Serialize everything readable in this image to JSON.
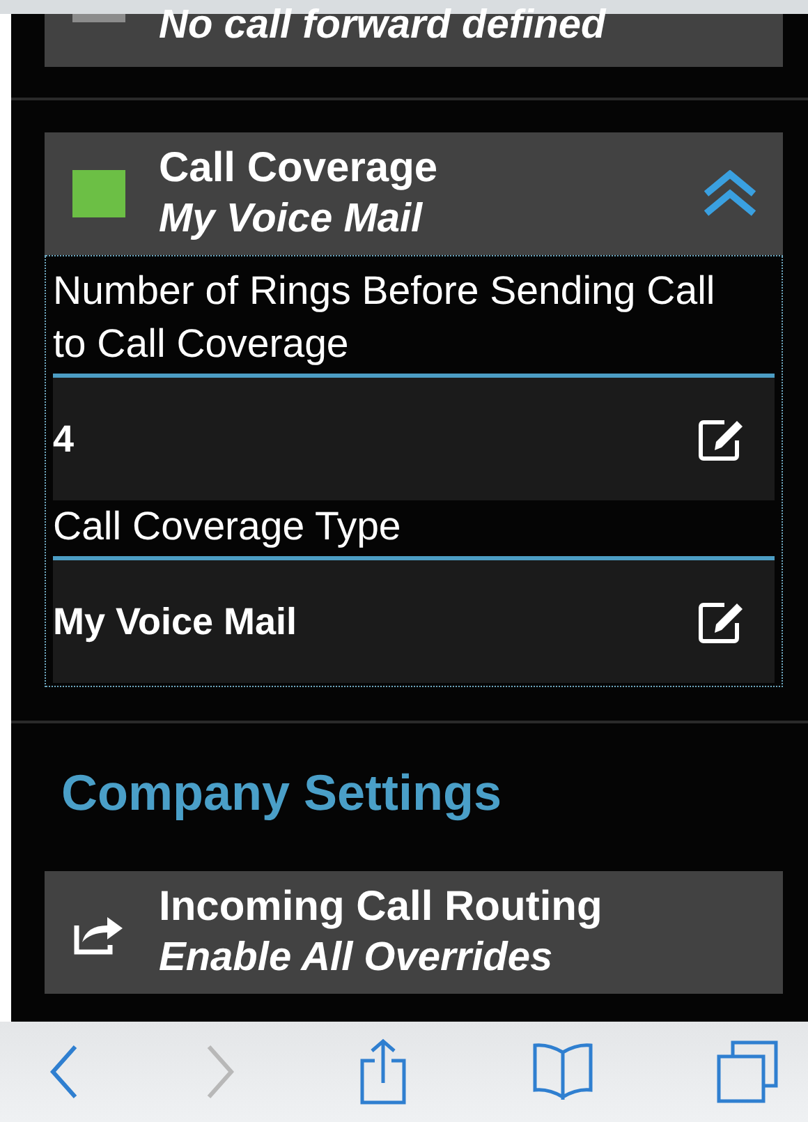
{
  "cards": [
    {
      "subtitle": "No call forward defined",
      "color": "#8c8c8c",
      "cut_top": true
    },
    {
      "title": "Call Coverage",
      "subtitle": "My Voice Mail",
      "color": "#6cbf45",
      "expanded": true,
      "fields": [
        {
          "label": "Number of Rings Before Sending Call to Call Coverage",
          "value": "4"
        },
        {
          "label": "Call Coverage Type",
          "value": "My Voice Mail"
        }
      ]
    }
  ],
  "company_heading": "Company Settings",
  "routing_card": {
    "title": "Incoming Call Routing",
    "subtitle": "Enable All Overrides"
  },
  "toolbar": [
    {
      "kind": "back",
      "disabled": false
    },
    {
      "kind": "forward",
      "disabled": true
    },
    {
      "kind": "share",
      "disabled": false
    },
    {
      "kind": "bookmarks",
      "disabled": false
    },
    {
      "kind": "tabs",
      "disabled": false
    }
  ]
}
